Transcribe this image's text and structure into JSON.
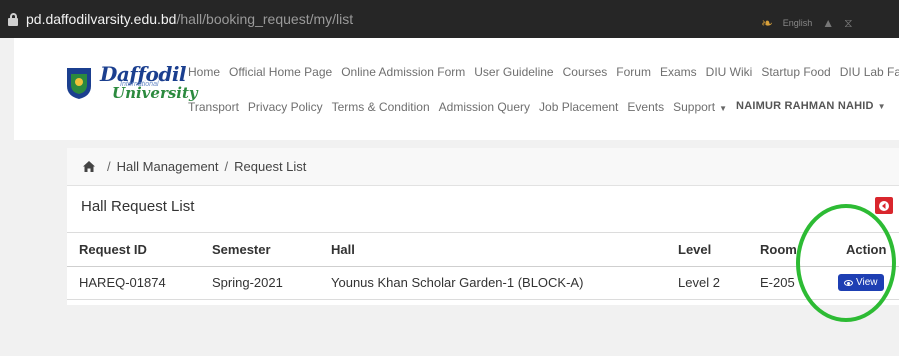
{
  "browser": {
    "url_domain": "pd.daffodilvarsity.edu.bd",
    "url_path": "/hall/booking_request/my/list",
    "extension_text": "English"
  },
  "header": {
    "logo_line1": "Daffodil",
    "logo_line_mid": "International",
    "logo_line2": "University",
    "nav_row1": [
      "Home",
      "Official Home Page",
      "Online Admission Form",
      "User Guideline",
      "Courses",
      "Forum",
      "Exams",
      "DIU Wiki",
      "Startup Food",
      "DIU Lab Facilities"
    ],
    "nav_row2": [
      "Transport",
      "Privacy Policy",
      "Terms & Condition",
      "Admission Query",
      "Job Placement",
      "Events"
    ],
    "support_label": "Support",
    "user_name": "NAIMUR RAHMAN NAHID"
  },
  "breadcrumb": {
    "items": [
      "Hall Management",
      "Request List"
    ]
  },
  "page": {
    "title": "Hall Request List"
  },
  "table": {
    "headers": [
      "Request ID",
      "Semester",
      "Hall",
      "Level",
      "Room",
      "Action"
    ],
    "rows": [
      {
        "request_id": "HAREQ-01874",
        "semester": "Spring-2021",
        "hall": "Younus Khan Scholar Garden-1 (BLOCK-A)",
        "level": "Level 2",
        "room": "E-205",
        "action_label": "View"
      }
    ]
  },
  "colors": {
    "view_button": "#1e3fb3",
    "back_button": "#d9262d",
    "annotation_circle": "#2dbb34"
  },
  "icons": [
    "lock-icon",
    "home-icon",
    "back-arrow-icon",
    "eye-icon",
    "logo-icon"
  ]
}
